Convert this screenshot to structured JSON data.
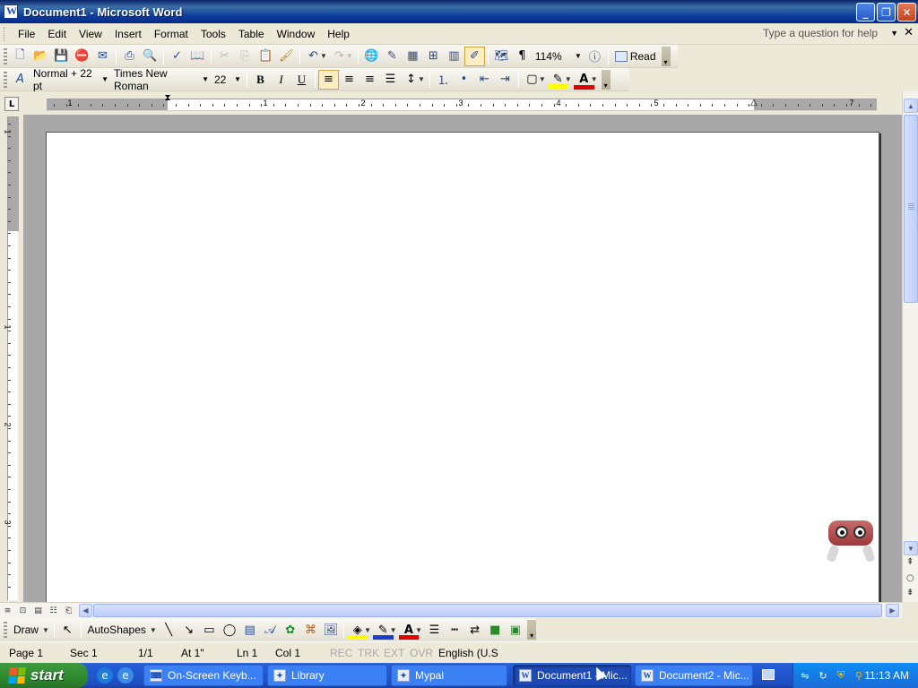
{
  "window": {
    "title": "Document1 - Microsoft Word",
    "minimize": "_",
    "maximize": "❐",
    "close": "✕"
  },
  "menu": {
    "items": [
      "File",
      "Edit",
      "View",
      "Insert",
      "Format",
      "Tools",
      "Table",
      "Window",
      "Help"
    ],
    "help_prompt": "Type a question for help"
  },
  "standard_toolbar": {
    "zoom": "114%",
    "read_label": "Read"
  },
  "formatting_toolbar": {
    "style": "Normal + 22 pt",
    "font": "Times New Roman",
    "size": "22",
    "bold": "B",
    "italic": "I",
    "underline": "U"
  },
  "ruler": {
    "labels": [
      "1",
      "1",
      "2",
      "3",
      "4",
      "5",
      "7"
    ],
    "vertical_labels": [
      "1",
      "1",
      "2",
      "3"
    ]
  },
  "drawing_toolbar": {
    "draw_label": "Draw",
    "autoshapes_label": "AutoShapes"
  },
  "status": {
    "page": "Page  1",
    "sec": "Sec  1",
    "pages": "1/1",
    "at": "At  1\"",
    "ln": "Ln  1",
    "col": "Col  1",
    "rec": "REC",
    "trk": "TRK",
    "ext": "EXT",
    "ovr": "OVR",
    "language": "English (U.S"
  },
  "taskbar": {
    "start_label": "start",
    "tasks": [
      {
        "label": "On-Screen Keyb...",
        "active": false
      },
      {
        "label": "Library",
        "active": false
      },
      {
        "label": "Mypal",
        "active": false
      },
      {
        "label": "Document1 - Mic...",
        "active": true
      },
      {
        "label": "Document2 - Mic...",
        "active": false
      }
    ],
    "clock": "11:13 AM"
  },
  "colors": {
    "title_bar": "#0b3c9e",
    "taskbar": "#245dd7",
    "start_button": "#2f8a2f",
    "highlight": "#ffff00",
    "font_color": "#e00000"
  }
}
